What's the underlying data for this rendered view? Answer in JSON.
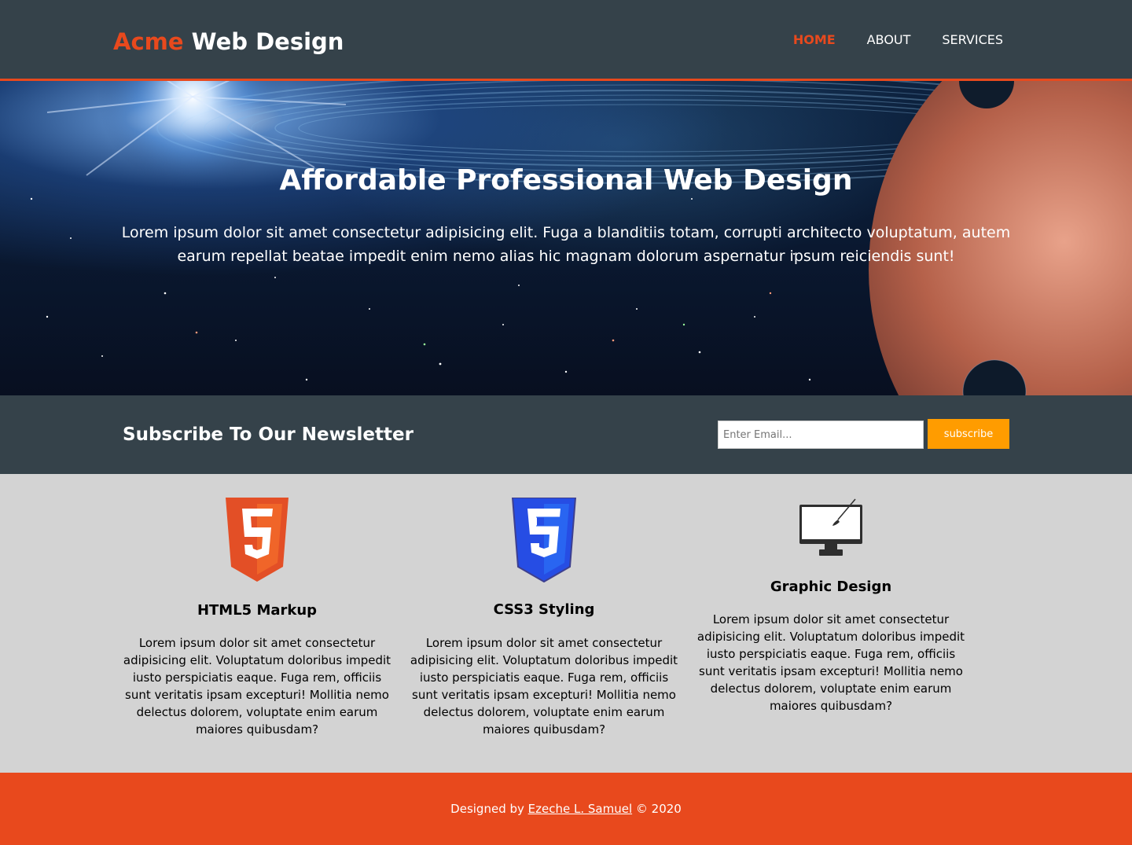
{
  "header": {
    "logo_highlight": "Acme",
    "logo_rest": " Web Design",
    "nav": [
      {
        "label": "HOME"
      },
      {
        "label": "ABOUT"
      },
      {
        "label": "SERVICES"
      }
    ]
  },
  "hero": {
    "title": "Affordable Professional Web Design",
    "text": "Lorem ipsum dolor sit amet consectetur adipisicing elit. Fuga a blanditiis totam, corrupti architecto voluptatum, autem earum repellat beatae impedit enim nemo alias hic magnam dolorum aspernatur ipsum reiciendis sunt!"
  },
  "newsletter": {
    "title": "Subscribe To Our Newsletter",
    "email_placeholder": "Enter Email...",
    "button_label": "subscribe"
  },
  "boxes": [
    {
      "icon": "html5-logo-icon",
      "title": "HTML5 Markup",
      "text": "Lorem ipsum dolor sit amet consectetur adipisicing elit. Voluptatum doloribus impedit iusto perspiciatis eaque. Fuga rem, officiis sunt veritatis ipsam excepturi! Mollitia nemo delectus dolorem, voluptate enim earum maiores quibusdam?"
    },
    {
      "icon": "css3-logo-icon",
      "title": "CSS3 Styling",
      "text": "Lorem ipsum dolor sit amet consectetur adipisicing elit. Voluptatum doloribus impedit iusto perspiciatis eaque. Fuga rem, officiis sunt veritatis ipsam excepturi! Mollitia nemo delectus dolorem, voluptate enim earum maiores quibusdam?"
    },
    {
      "icon": "monitor-brush-icon",
      "title": "Graphic Design",
      "text": "Lorem ipsum dolor sit amet consectetur adipisicing elit. Voluptatum doloribus impedit iusto perspiciatis eaque. Fuga rem, officiis sunt veritatis ipsam excepturi! Mollitia nemo delectus dolorem, voluptate enim earum maiores quibusdam?"
    }
  ],
  "footer": {
    "prefix": "Designed by ",
    "author": "Ezeche L. Samuel",
    "suffix": " © 2020"
  },
  "colors": {
    "accent": "#e8491d",
    "header_bg": "#35424a",
    "button": "#ff9c00",
    "body_bg": "#d3d3d3"
  }
}
